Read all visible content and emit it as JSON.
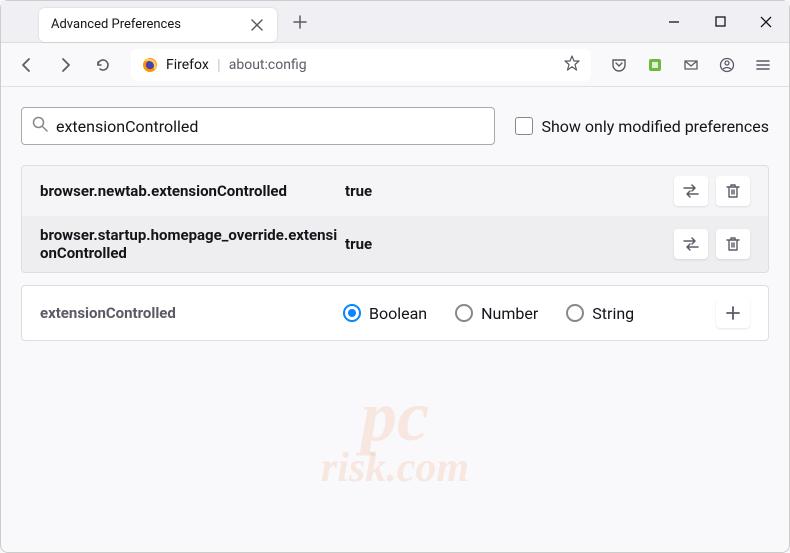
{
  "tab": {
    "title": "Advanced Preferences"
  },
  "urlbar": {
    "prefix": "Firefox",
    "url": "about:config"
  },
  "search": {
    "value": "extensionControlled"
  },
  "checkbox_label": "Show only modified preferences",
  "prefs": [
    {
      "name": "browser.newtab.extensionControlled",
      "value": "true"
    },
    {
      "name": "browser.startup.homepage_override.extensionControlled",
      "value": "true"
    }
  ],
  "new_pref": {
    "name": "extensionControlled",
    "types": [
      "Boolean",
      "Number",
      "String"
    ],
    "selected": "Boolean"
  },
  "watermark": {
    "top": "pc",
    "bottom": "risk.com"
  }
}
